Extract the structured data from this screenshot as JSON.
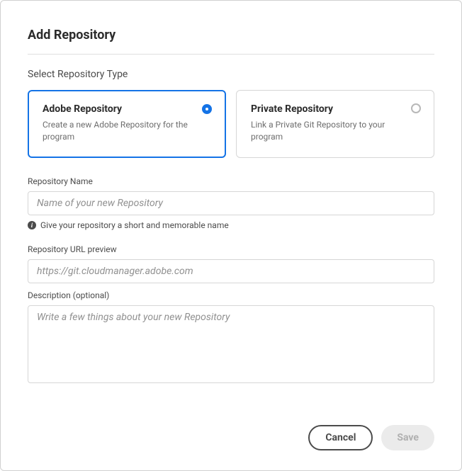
{
  "dialog": {
    "title": "Add Repository",
    "section_label": "Select Repository Type"
  },
  "type_options": {
    "adobe": {
      "title": "Adobe Repository",
      "desc": "Create a new Adobe Repository for the program"
    },
    "private": {
      "title": "Private Repository",
      "desc": "Link a Private Git Repository to your program"
    }
  },
  "fields": {
    "name": {
      "label": "Repository Name",
      "placeholder": "Name of your new Repository",
      "hint": "Give your repository a short and memorable name"
    },
    "url": {
      "label": "Repository URL preview",
      "placeholder": "https://git.cloudmanager.adobe.com"
    },
    "description": {
      "label": "Description (optional)",
      "placeholder": "Write a few things about your new Repository"
    }
  },
  "buttons": {
    "cancel": "Cancel",
    "save": "Save"
  }
}
